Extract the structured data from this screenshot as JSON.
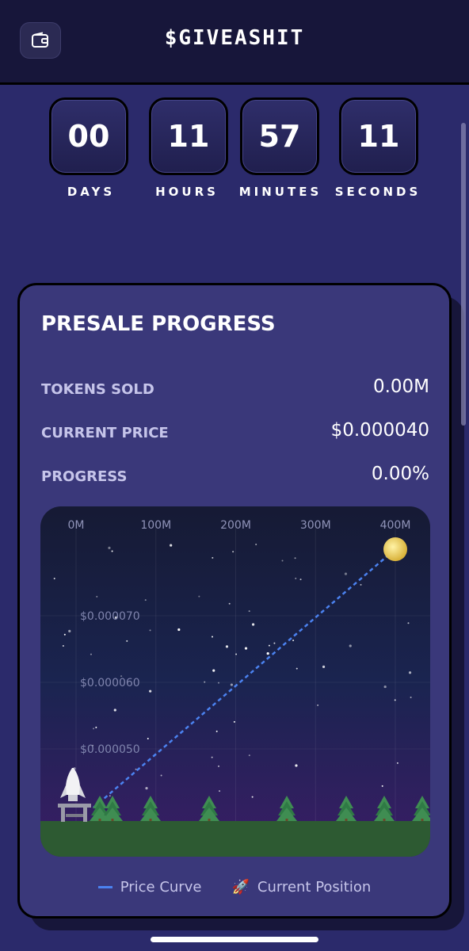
{
  "header": {
    "title": "$GIVEASHIT",
    "wallet_icon": "wallet-icon"
  },
  "countdown": [
    {
      "value": "00",
      "label": "DAYS"
    },
    {
      "value": "11",
      "label": "HOURS"
    },
    {
      "value": "57",
      "label": "MINUTES"
    },
    {
      "value": "11",
      "label": "SECONDS"
    }
  ],
  "presale": {
    "title": "PRESALE PROGRESS",
    "stats": [
      {
        "label": "TOKENS SOLD",
        "value": "0.00M"
      },
      {
        "label": "CURRENT PRICE",
        "value": "$0.000040"
      },
      {
        "label": "PROGRESS",
        "value": "0.00%"
      }
    ]
  },
  "chart_data": {
    "type": "line",
    "x_ticks": [
      "0M",
      "100M",
      "200M",
      "300M",
      "400M"
    ],
    "y_ticks": [
      "$0.000050",
      "$0.000060",
      "$0.000070"
    ],
    "series": [
      {
        "name": "Price Curve",
        "x": [
          0,
          400
        ],
        "y": [
          4e-05,
          8e-05
        ]
      }
    ],
    "current_position": {
      "x": 0,
      "y": 4e-05
    },
    "xlim": [
      0,
      400
    ],
    "ylim": [
      4e-05,
      8e-05
    ],
    "colors": {
      "line": "#4b82f0",
      "ground": "#2d5a32",
      "sky_top": "#161a34",
      "sky_bottom": "#3a1d66"
    }
  },
  "legend": {
    "price_curve": "Price Curve",
    "current_position": "Current Position",
    "rocket_icon": "🚀"
  },
  "colors": {
    "accent": "#4b82f0",
    "background": "#2b2a6b",
    "card": "#3a387a"
  }
}
